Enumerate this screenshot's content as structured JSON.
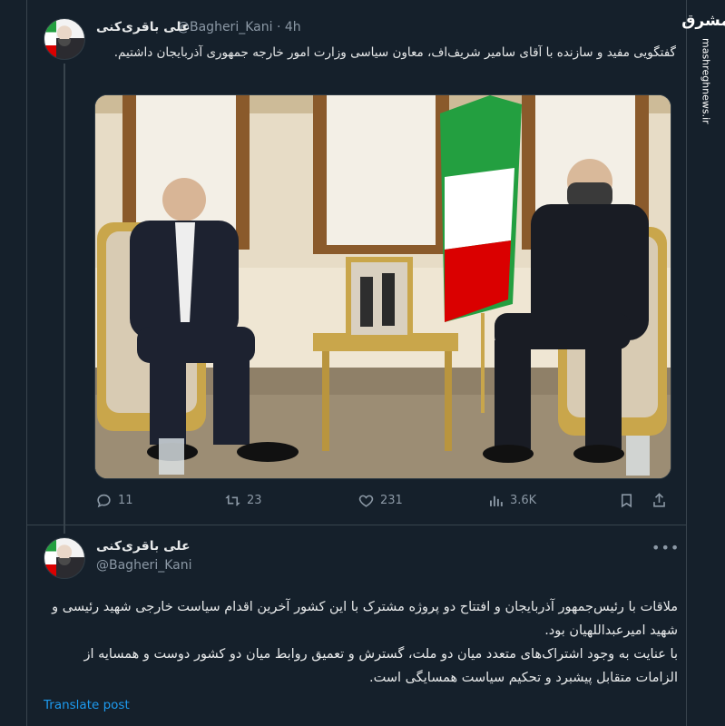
{
  "tweet1": {
    "name": "علی باقری‌کنی",
    "handle": "@Bagheri_Kani",
    "time": "· 4h",
    "text": "گفتگویی مفید و سازنده با آقای سامیر شریف‌اف، معاون سیاسی وزارت امور خارجه جمهوری آذربایجان داشتیم.",
    "stats": {
      "replies": "11",
      "reposts": "23",
      "likes": "231",
      "views": "3.6K"
    }
  },
  "tweet2": {
    "name": "علی باقری‌کنی",
    "handle": "@Bagheri_Kani",
    "paragraph1": "ملاقات با رئیس‌جمهور آذربایجان و افتتاح دو پروژه مشترک با این کشور آخرین اقدام سیاست خارجی شهید رئیسی و شهید امیرعبداللهیان بود.",
    "paragraph2": "با عنایت به وجود اشتراک‌های متعدد میان دو ملت، گسترش و تعمیق روابط میان دو کشور دوست و همسایه از الزامات متقابل پیشبرد و تحکیم سیاست همسایگی است.",
    "translate_label": "Translate post"
  },
  "watermark": {
    "logo": "مشرق",
    "site": "mashreghnews.ir"
  },
  "colors": {
    "background": "#15202b",
    "accent": "#1d9bf0",
    "muted": "#8b98a5"
  }
}
